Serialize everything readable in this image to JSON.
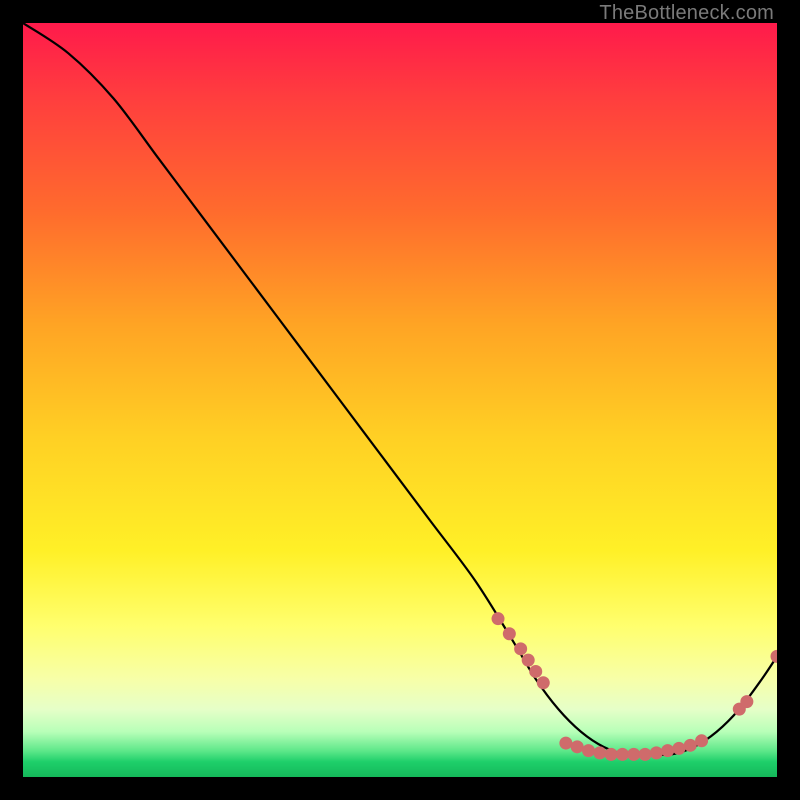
{
  "watermark": "TheBottleneck.com",
  "chart_data": {
    "type": "line",
    "title": "",
    "xlabel": "",
    "ylabel": "",
    "xlim": [
      0,
      100
    ],
    "ylim": [
      0,
      100
    ],
    "grid": false,
    "series": [
      {
        "name": "curve",
        "color": "#000000",
        "x": [
          0,
          6,
          12,
          18,
          24,
          30,
          36,
          42,
          48,
          54,
          60,
          65,
          68,
          71,
          74,
          77,
          80,
          83,
          86,
          89,
          92,
          95,
          98,
          100
        ],
        "y": [
          100,
          96,
          90,
          82,
          74,
          66,
          58,
          50,
          42,
          34,
          26,
          18,
          13,
          9,
          6,
          4,
          3,
          3,
          3,
          4,
          6,
          9,
          13,
          16
        ]
      }
    ],
    "markers": [
      {
        "name": "cluster-descent",
        "color": "#cf6b6b",
        "radius": 6.5,
        "x": [
          63,
          64.5,
          66,
          67,
          68,
          69
        ],
        "y": [
          21,
          19,
          17,
          15.5,
          14,
          12.5
        ]
      },
      {
        "name": "cluster-valley",
        "color": "#cf6b6b",
        "radius": 6.5,
        "x": [
          72,
          73.5,
          75,
          76.5,
          78,
          79.5,
          81,
          82.5,
          84,
          85.5,
          87,
          88.5,
          90
        ],
        "y": [
          4.5,
          4,
          3.5,
          3.2,
          3,
          3,
          3,
          3,
          3.2,
          3.5,
          3.8,
          4.2,
          4.8
        ]
      },
      {
        "name": "cluster-ascent",
        "color": "#cf6b6b",
        "radius": 6.5,
        "x": [
          95,
          96
        ],
        "y": [
          9,
          10
        ]
      },
      {
        "name": "point-end",
        "color": "#cf6b6b",
        "radius": 6.5,
        "x": [
          100
        ],
        "y": [
          16
        ]
      }
    ]
  }
}
